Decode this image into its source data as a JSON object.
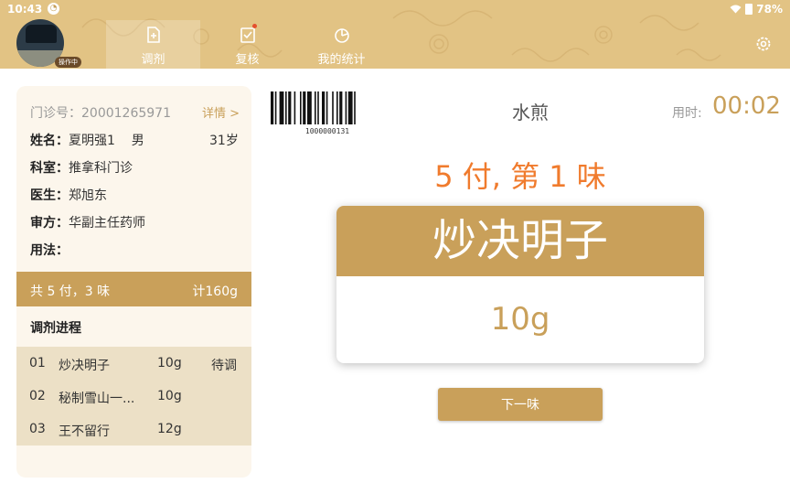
{
  "status_bar": {
    "time": "10:43",
    "battery": "78%"
  },
  "header": {
    "avatar_badge": "操作中",
    "tabs": [
      {
        "label": "调剂",
        "icon": "document-plus-icon",
        "active": true
      },
      {
        "label": "复核",
        "icon": "checklist-icon",
        "active": false
      },
      {
        "label": "我的统计",
        "icon": "pie-chart-icon",
        "active": false
      }
    ],
    "settings_icon": "gear-icon"
  },
  "patient": {
    "clinic_label": "门诊号：",
    "clinic_no": "20001265971",
    "details_link": "详情 >",
    "name_label": "姓名：",
    "name": "夏明强1",
    "gender": "男",
    "age": "31岁",
    "dept_label": "科室：",
    "dept": "推拿科门诊",
    "doctor_label": "医生：",
    "doctor": "郑旭东",
    "reviewer_label": "审方：",
    "reviewer": "华副主任药师",
    "usage_label": "用法：",
    "usage": ""
  },
  "summary": {
    "left": "共 5 付，3 味",
    "right": "计160g"
  },
  "progress": {
    "title": "调剂进程",
    "items": [
      {
        "idx": "01",
        "name": "炒决明子",
        "amount": "10g",
        "status": "待调"
      },
      {
        "idx": "02",
        "name": "秘制雪山一...",
        "amount": "10g",
        "status": ""
      },
      {
        "idx": "03",
        "name": "王不留行",
        "amount": "12g",
        "status": ""
      }
    ]
  },
  "main": {
    "barcode_number": "1000000131",
    "method": "水煎",
    "time_label": "用时:",
    "time_value": "00:02",
    "doses": "5 付, 第 1 味",
    "herb_name": "炒决明子",
    "herb_amount": "10g",
    "next_button": "下一味"
  },
  "colors": {
    "accent": "#c9a05a",
    "orange": "#f07b2d",
    "header": "#e2c384"
  }
}
